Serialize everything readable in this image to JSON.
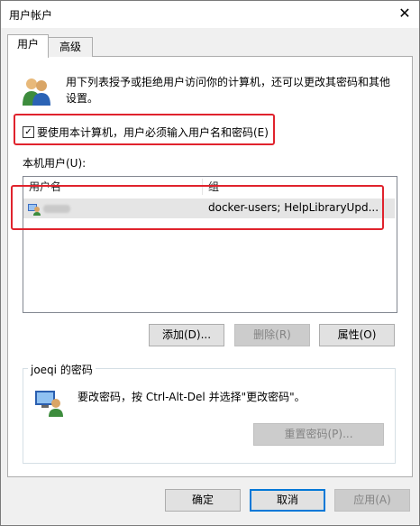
{
  "window": {
    "title": "用户帐户",
    "close_glyph": "✕"
  },
  "tabs": [
    {
      "label": "用户",
      "active": true
    },
    {
      "label": "高级",
      "active": false
    }
  ],
  "info_text": "用下列表授予或拒绝用户访问你的计算机，还可以更改其密码和其他设置。",
  "require_password": {
    "label": "要使用本计算机，用户必须输入用户名和密码(E)",
    "checked": true,
    "check_glyph": "✓"
  },
  "local_users": {
    "label": "本机用户(U):",
    "columns": [
      "用户名",
      "组"
    ],
    "rows": [
      {
        "username": "",
        "groups": "docker-users; HelpLibraryUpd..."
      }
    ]
  },
  "buttons": {
    "add": "添加(D)...",
    "remove": "删除(R)",
    "properties": "属性(O)"
  },
  "password_group": {
    "title": "joeqi 的密码",
    "text": "要改密码，按 Ctrl-Alt-Del 并选择\"更改密码\"。",
    "reset_button": "重置密码(P)..."
  },
  "dialog_buttons": {
    "ok": "确定",
    "cancel": "取消",
    "apply": "应用(A)"
  },
  "colors": {
    "highlight": "#e0232d",
    "focus": "#0078d7"
  }
}
